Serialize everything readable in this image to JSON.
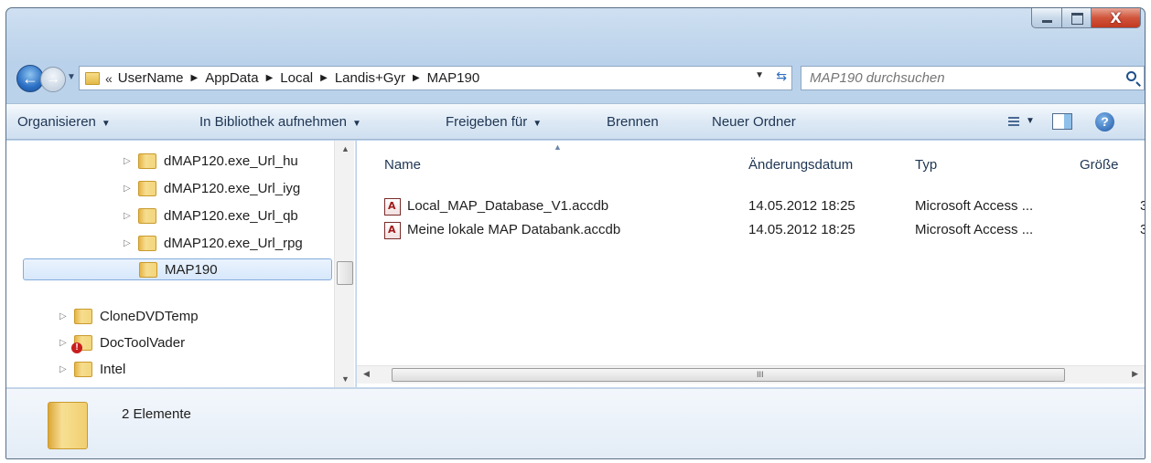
{
  "window": {
    "close_symbol": "X",
    "colors": {
      "frame": "#b9d1ea",
      "accent": "#2a6fc4",
      "close": "#c2391f"
    }
  },
  "address": {
    "chevron": "«",
    "crumbs": [
      "UserName",
      "AppData",
      "Local",
      "Landis+Gyr",
      "MAP190"
    ],
    "separator": "▶"
  },
  "search": {
    "placeholder": "MAP190 durchsuchen"
  },
  "toolbar": {
    "organize": "Organisieren",
    "library": "In Bibliothek aufnehmen",
    "share": "Freigeben für",
    "burn": "Brennen",
    "new_folder": "Neuer Ordner",
    "help": "?"
  },
  "nav": {
    "items": [
      {
        "label": "dMAP120.exe_Url_hu",
        "icon": "folder-icon"
      },
      {
        "label": "dMAP120.exe_Url_iyg",
        "icon": "folder-icon"
      },
      {
        "label": "dMAP120.exe_Url_qb",
        "icon": "folder-icon"
      },
      {
        "label": "dMAP120.exe_Url_rpg",
        "icon": "folder-icon"
      },
      {
        "label": "MAP190",
        "icon": "folder-icon",
        "selected": true
      },
      {
        "label": "CloneDVDTemp",
        "icon": "folder-icon"
      },
      {
        "label": "DocToolVader",
        "icon": "folder-warning-icon"
      },
      {
        "label": "Intel",
        "icon": "folder-icon"
      }
    ]
  },
  "columns": {
    "name": "Name",
    "date": "Änderungsdatum",
    "type": "Typ",
    "size": "Größe"
  },
  "files": [
    {
      "name": "Local_MAP_Database_V1.accdb",
      "date": "14.05.2012 18:25",
      "type": "Microsoft Access ...",
      "size": "3"
    },
    {
      "name": "Meine lokale MAP Databank.accdb",
      "date": "14.05.2012 18:25",
      "type": "Microsoft Access ...",
      "size": "3"
    }
  ],
  "scroll": {
    "grip": "III"
  },
  "details": {
    "count": "2 Elemente"
  }
}
